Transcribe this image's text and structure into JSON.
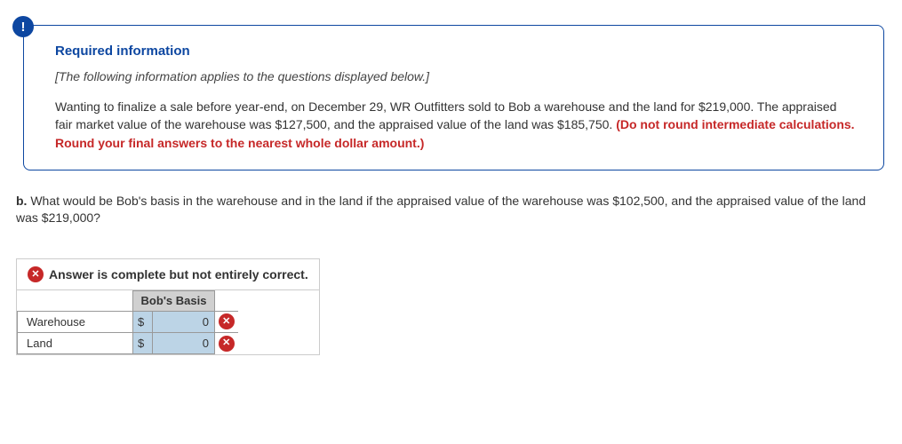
{
  "badge": "!",
  "required_info": {
    "title": "Required information",
    "applies": "[The following information applies to the questions displayed below.]",
    "body_part1": "Wanting to finalize a sale before year-end, on December 29, WR Outfitters sold to Bob a warehouse and the land for $219,000. The appraised fair market value of the warehouse was $127,500, and the appraised value of the land was $185,750. ",
    "body_red": "(Do not round intermediate calculations. Round your final answers to the nearest whole dollar amount.)"
  },
  "question": {
    "letter": "b.",
    "text": " What would be Bob's basis in the warehouse and in the land if the appraised value of the warehouse was $102,500, and the appraised value of the land was $219,000?"
  },
  "answer": {
    "status": "Answer is complete but not entirely correct.",
    "col_header": "Bob's Basis",
    "rows": [
      {
        "label": "Warehouse",
        "currency": "$",
        "value": "0",
        "correct": false
      },
      {
        "label": "Land",
        "currency": "$",
        "value": "0",
        "correct": false
      }
    ]
  }
}
